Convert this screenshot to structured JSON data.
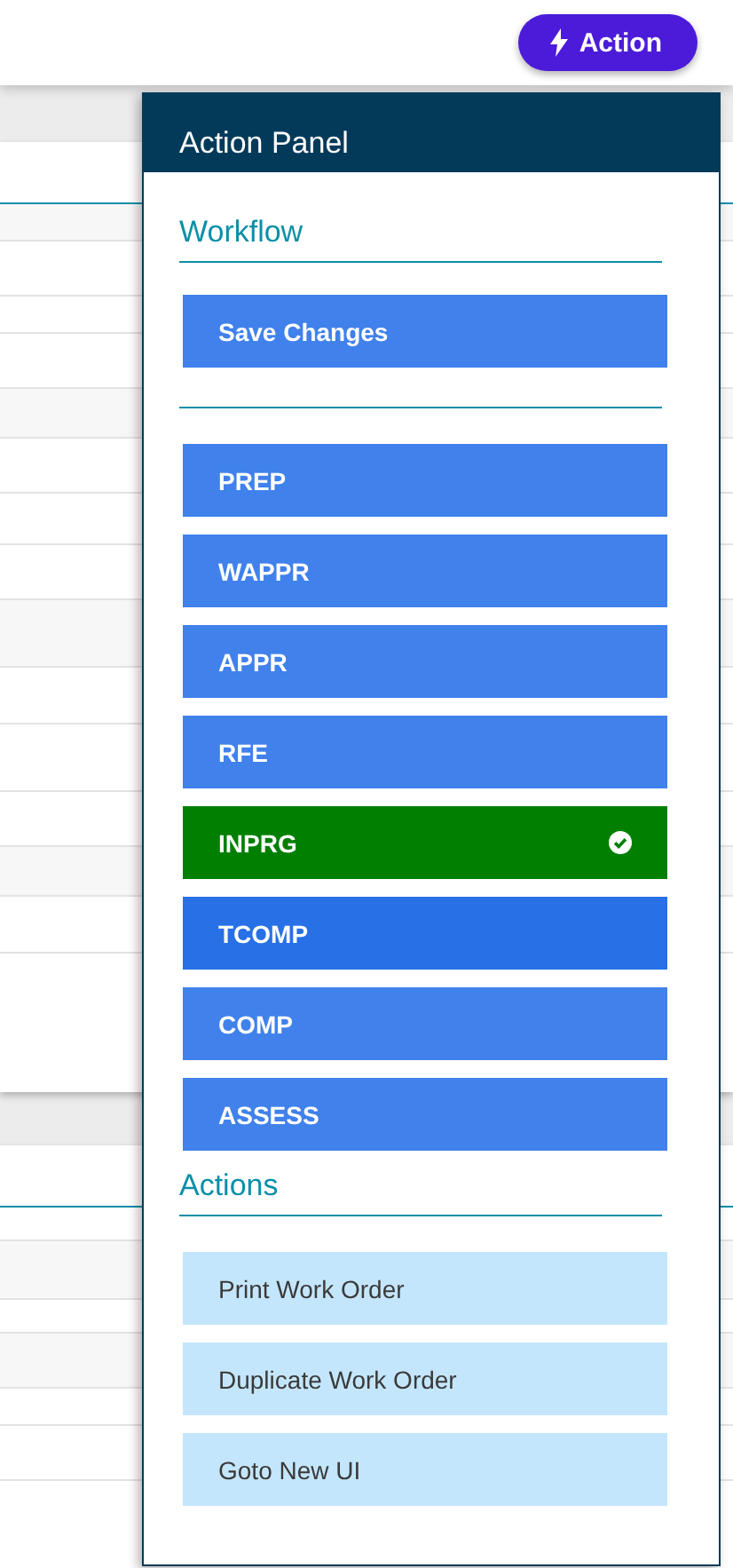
{
  "top_bar": {
    "action_button": "Action"
  },
  "action_panel": {
    "title": "Action Panel",
    "workflow": {
      "heading": "Workflow",
      "save_button": "Save Changes",
      "statuses": [
        {
          "label": "PREP",
          "selected": false,
          "hovered": false
        },
        {
          "label": "WAPPR",
          "selected": false,
          "hovered": false
        },
        {
          "label": "APPR",
          "selected": false,
          "hovered": false
        },
        {
          "label": "RFE",
          "selected": false,
          "hovered": false
        },
        {
          "label": "INPRG",
          "selected": true,
          "hovered": false
        },
        {
          "label": "TCOMP",
          "selected": false,
          "hovered": true
        },
        {
          "label": "COMP",
          "selected": false,
          "hovered": false
        },
        {
          "label": "ASSESS",
          "selected": false,
          "hovered": false
        }
      ]
    },
    "actions": {
      "heading": "Actions",
      "items": [
        "Print Work Order",
        "Duplicate Work Order",
        "Goto New UI"
      ]
    }
  }
}
